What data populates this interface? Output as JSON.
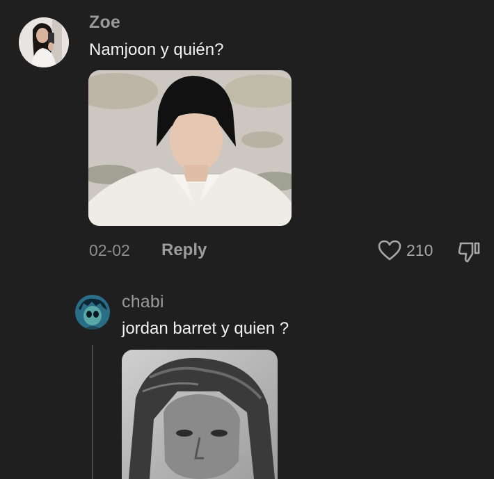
{
  "comment": {
    "username": "Zoe",
    "text": "Namjoon y quién?",
    "date": "02-02",
    "reply_label": "Reply",
    "like_count": "210"
  },
  "reply": {
    "username": "chabi",
    "text": "jordan barret y quien ?"
  },
  "icons": {
    "like": "heart-icon",
    "dislike": "thumbs-down-icon"
  },
  "colors": {
    "background": "#1f1f1f",
    "username": "#9a9a9a",
    "text": "#f2f2f2",
    "meta": "#8e8e8e"
  }
}
